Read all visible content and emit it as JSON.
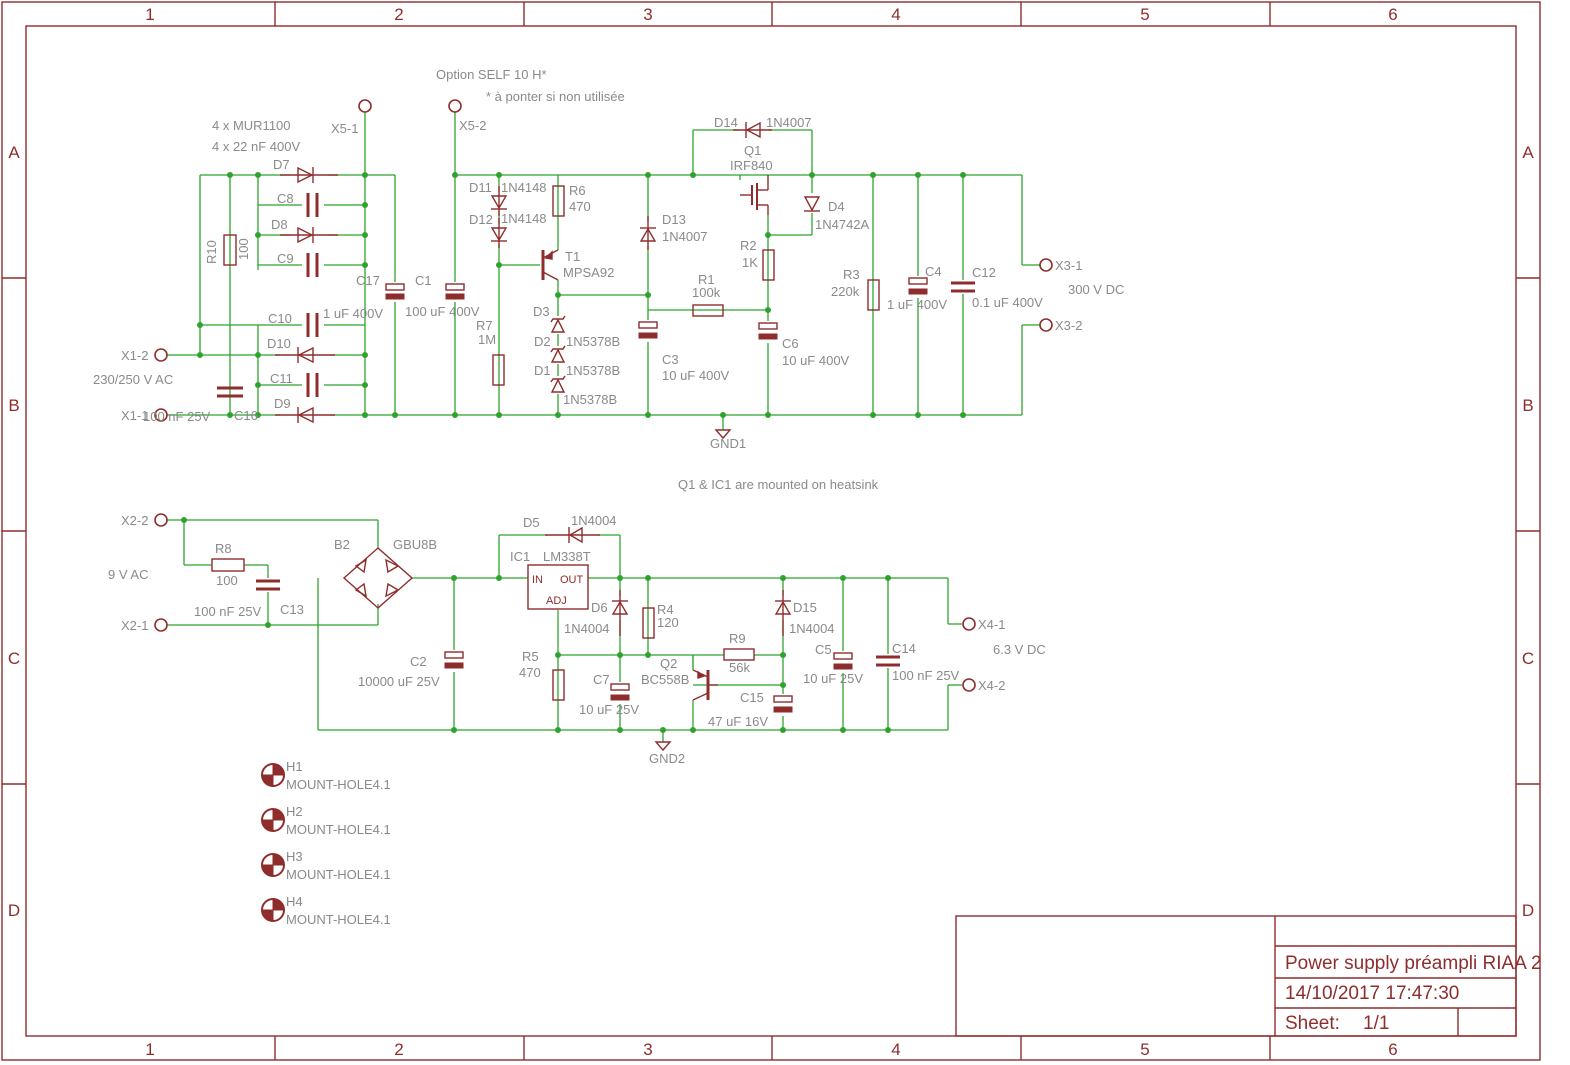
{
  "frame": {
    "columns": [
      "1",
      "2",
      "3",
      "4",
      "5",
      "6"
    ],
    "rows": [
      "A",
      "B",
      "C",
      "D"
    ]
  },
  "title_block": {
    "title": "Power supply préampli RIAA 2",
    "date": "14/10/2017 17:47:30",
    "sheet_label": "Sheet:",
    "sheet_value": "1/1"
  },
  "notes": {
    "option": "Option SELF 10 H*",
    "jumper": "* à ponter si non utilisée",
    "rectifiers": "4 x MUR1100",
    "caps": "4 x 22 nF 400V",
    "heatsink": "Q1 & IC1 are mounted on heatsink"
  },
  "hv": {
    "x5_1": "X5-1",
    "x5_2": "X5-2",
    "x1_2": "X1-2",
    "x1_1": "X1-1",
    "ac_in": "230/250 V AC",
    "x3_1": "X3-1",
    "x3_2": "X3-2",
    "dc_out": "300 V DC",
    "r10": "R10",
    "r10_val": "100",
    "c15": "C16",
    "c15_val": "100 nF 25V",
    "d7": "D7",
    "d8": "D8",
    "d9": "D9",
    "d10": "D10",
    "c8": "C8",
    "c9": "C9",
    "c10": "C10",
    "c11": "C11",
    "c10_val": "1 uF 400V",
    "c17": "C17",
    "c1": "C1",
    "c1_val": "100 uF 400V",
    "d11": "D11",
    "d11_val": "1N4148",
    "d12": "D12",
    "d12_val": "1N4148",
    "r6": "R6",
    "r6_val": "470",
    "r7": "R7",
    "r7_val": "1M",
    "t1": "T1",
    "t1_val": "MPSA92",
    "d3": "D3",
    "d2": "D2",
    "d2_val": "1N5378B",
    "d1": "D1",
    "d1_val": "1N5378B",
    "d3_val": "1N5378B",
    "d13": "D13",
    "d13_val": "1N4007",
    "d14": "D14",
    "d14_val": "1N4007",
    "q1": "Q1",
    "q1_val": "IRF840",
    "d4": "D4",
    "d4_val": "1N4742A",
    "r2": "R2",
    "r2_val": "1K",
    "r1": "R1",
    "r1_val": "100k",
    "c3": "C3",
    "c3_val": "10 uF 400V",
    "c6": "C6",
    "c6_val": "10 uF 400V",
    "r3": "R3",
    "r3_val": "220k",
    "c4": "C4",
    "c4_val": "1 uF 400V",
    "c12": "C12",
    "c12_val": "0.1 uF 400V",
    "gnd1": "GND1"
  },
  "lv": {
    "x2_2": "X2-2",
    "x2_1": "X2-1",
    "ac_in": "9 V AC",
    "r8": "R8",
    "r8_val": "100",
    "c13": "C13",
    "c13_val": "100 nF 25V",
    "b2": "B2",
    "b2_val": "GBU8B",
    "c2": "C2",
    "c2_val": "10000 uF 25V",
    "d5": "D5",
    "d5_val": "1N4004",
    "ic1": "IC1",
    "ic1_val": "LM338T",
    "ic_in": "IN",
    "ic_out": "OUT",
    "ic_adj": "ADJ",
    "d6": "D6",
    "d6_val": "1N4004",
    "r4": "R4",
    "r4_val": "120",
    "r5": "R5",
    "r5_val": "470",
    "c7": "C7",
    "c7_val": "10 uF 25V",
    "q2": "Q2",
    "q2_val": "BC558B",
    "r9": "R9",
    "r9_val": "56k",
    "d15": "D15",
    "d15_val": "1N4004",
    "c15": "C15",
    "c15_val": "47 uF 16V",
    "c5": "C5",
    "c5_val": "10 uF 25V",
    "c14": "C14",
    "c14_val": "100 nF 25V",
    "x4_1": "X4-1",
    "x4_2": "X4-2",
    "dc_out": "6.3 V DC",
    "gnd2": "GND2"
  },
  "holes": [
    {
      "ref": "H1",
      "value": "MOUNT-HOLE4.1"
    },
    {
      "ref": "H2",
      "value": "MOUNT-HOLE4.1"
    },
    {
      "ref": "H3",
      "value": "MOUNT-HOLE4.1"
    },
    {
      "ref": "H4",
      "value": "MOUNT-HOLE4.1"
    }
  ]
}
